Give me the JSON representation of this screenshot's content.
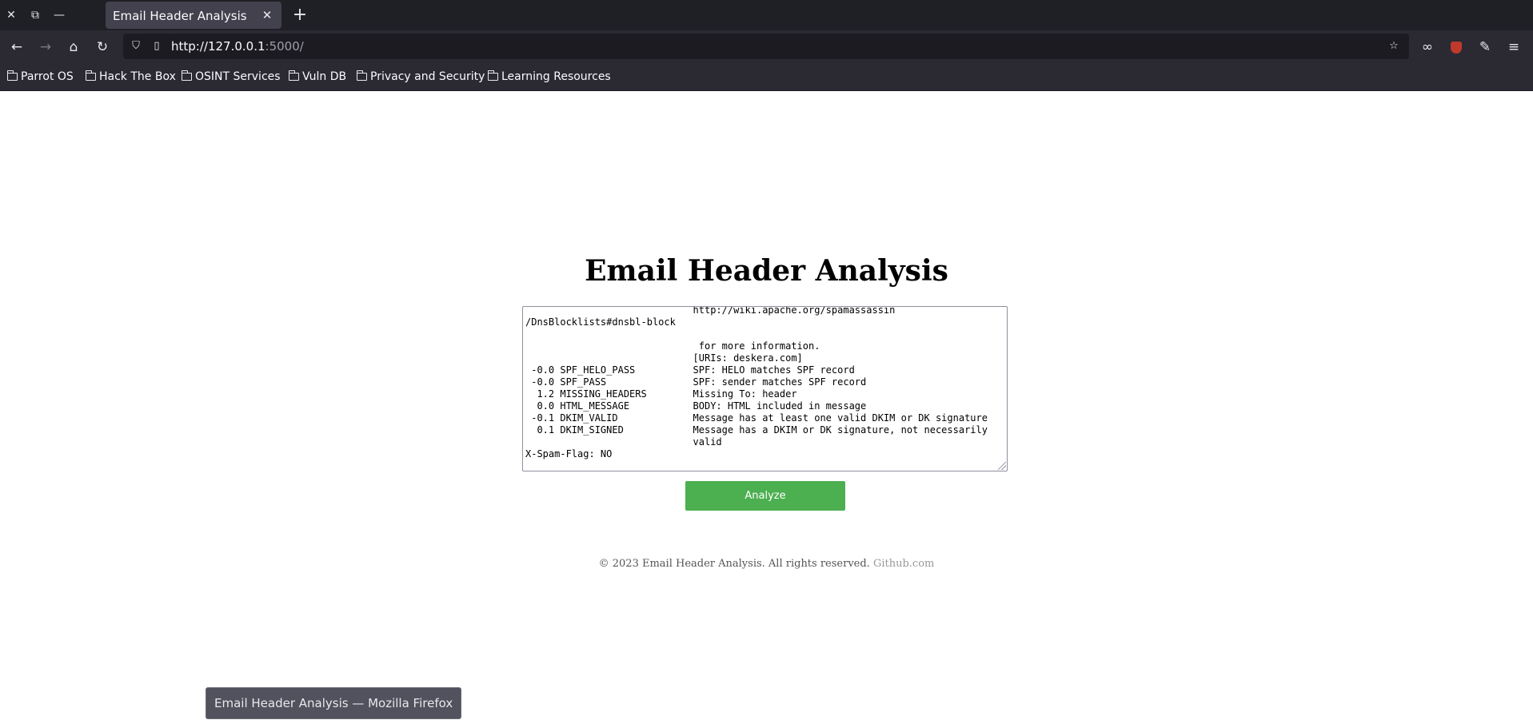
{
  "browser": {
    "tab_title": "Email Header Analysis",
    "url_host": "http://127.0.0.1",
    "url_rest": ":5000/",
    "window_title_tooltip": "Email Header Analysis — Mozilla Firefox"
  },
  "bookmarks": [
    {
      "label": "Parrot OS"
    },
    {
      "label": "Hack The Box"
    },
    {
      "label": "OSINT Services"
    },
    {
      "label": "Vuln DB"
    },
    {
      "label": "Privacy and Security"
    },
    {
      "label": "Learning Resources"
    }
  ],
  "main": {
    "title": "Email Header Analysis",
    "header_text": "                             http://wiki.apache.org/spamassassin\n/DnsBlocklists#dnsbl-block\n\n                              for more information.\n                             [URIs: deskera.com]\n -0.0 SPF_HELO_PASS          SPF: HELO matches SPF record\n -0.0 SPF_PASS               SPF: sender matches SPF record\n  1.2 MISSING_HEADERS        Missing To: header\n  0.0 HTML_MESSAGE           BODY: HTML included in message\n -0.1 DKIM_VALID             Message has at least one valid DKIM or DK signature\n  0.1 DKIM_SIGNED            Message has a DKIM or DK signature, not necessarily\n                             valid\nX-Spam-Flag: NO",
    "analyze_label": "Analyze"
  },
  "footer": {
    "text": "© 2023 Email Header Analysis. All rights reserved.",
    "link": "Github.com"
  },
  "icons": {
    "close": "close-icon",
    "restore": "restore-icon",
    "minimize": "minimize-icon",
    "back": "back-arrow-icon",
    "forward": "forward-arrow-icon",
    "home": "home-icon",
    "reload": "reload-icon",
    "shield": "shield-icon",
    "page": "page-icon",
    "star": "star-icon",
    "mask": "private-mask-icon",
    "ublock": "ublock-icon",
    "wrench": "wrench-icon",
    "menu": "hamburger-menu-icon"
  },
  "colors": {
    "accent_button": "#4caf50",
    "chrome_dark": "#1f1f26",
    "chrome_bar": "#2b2a33"
  }
}
